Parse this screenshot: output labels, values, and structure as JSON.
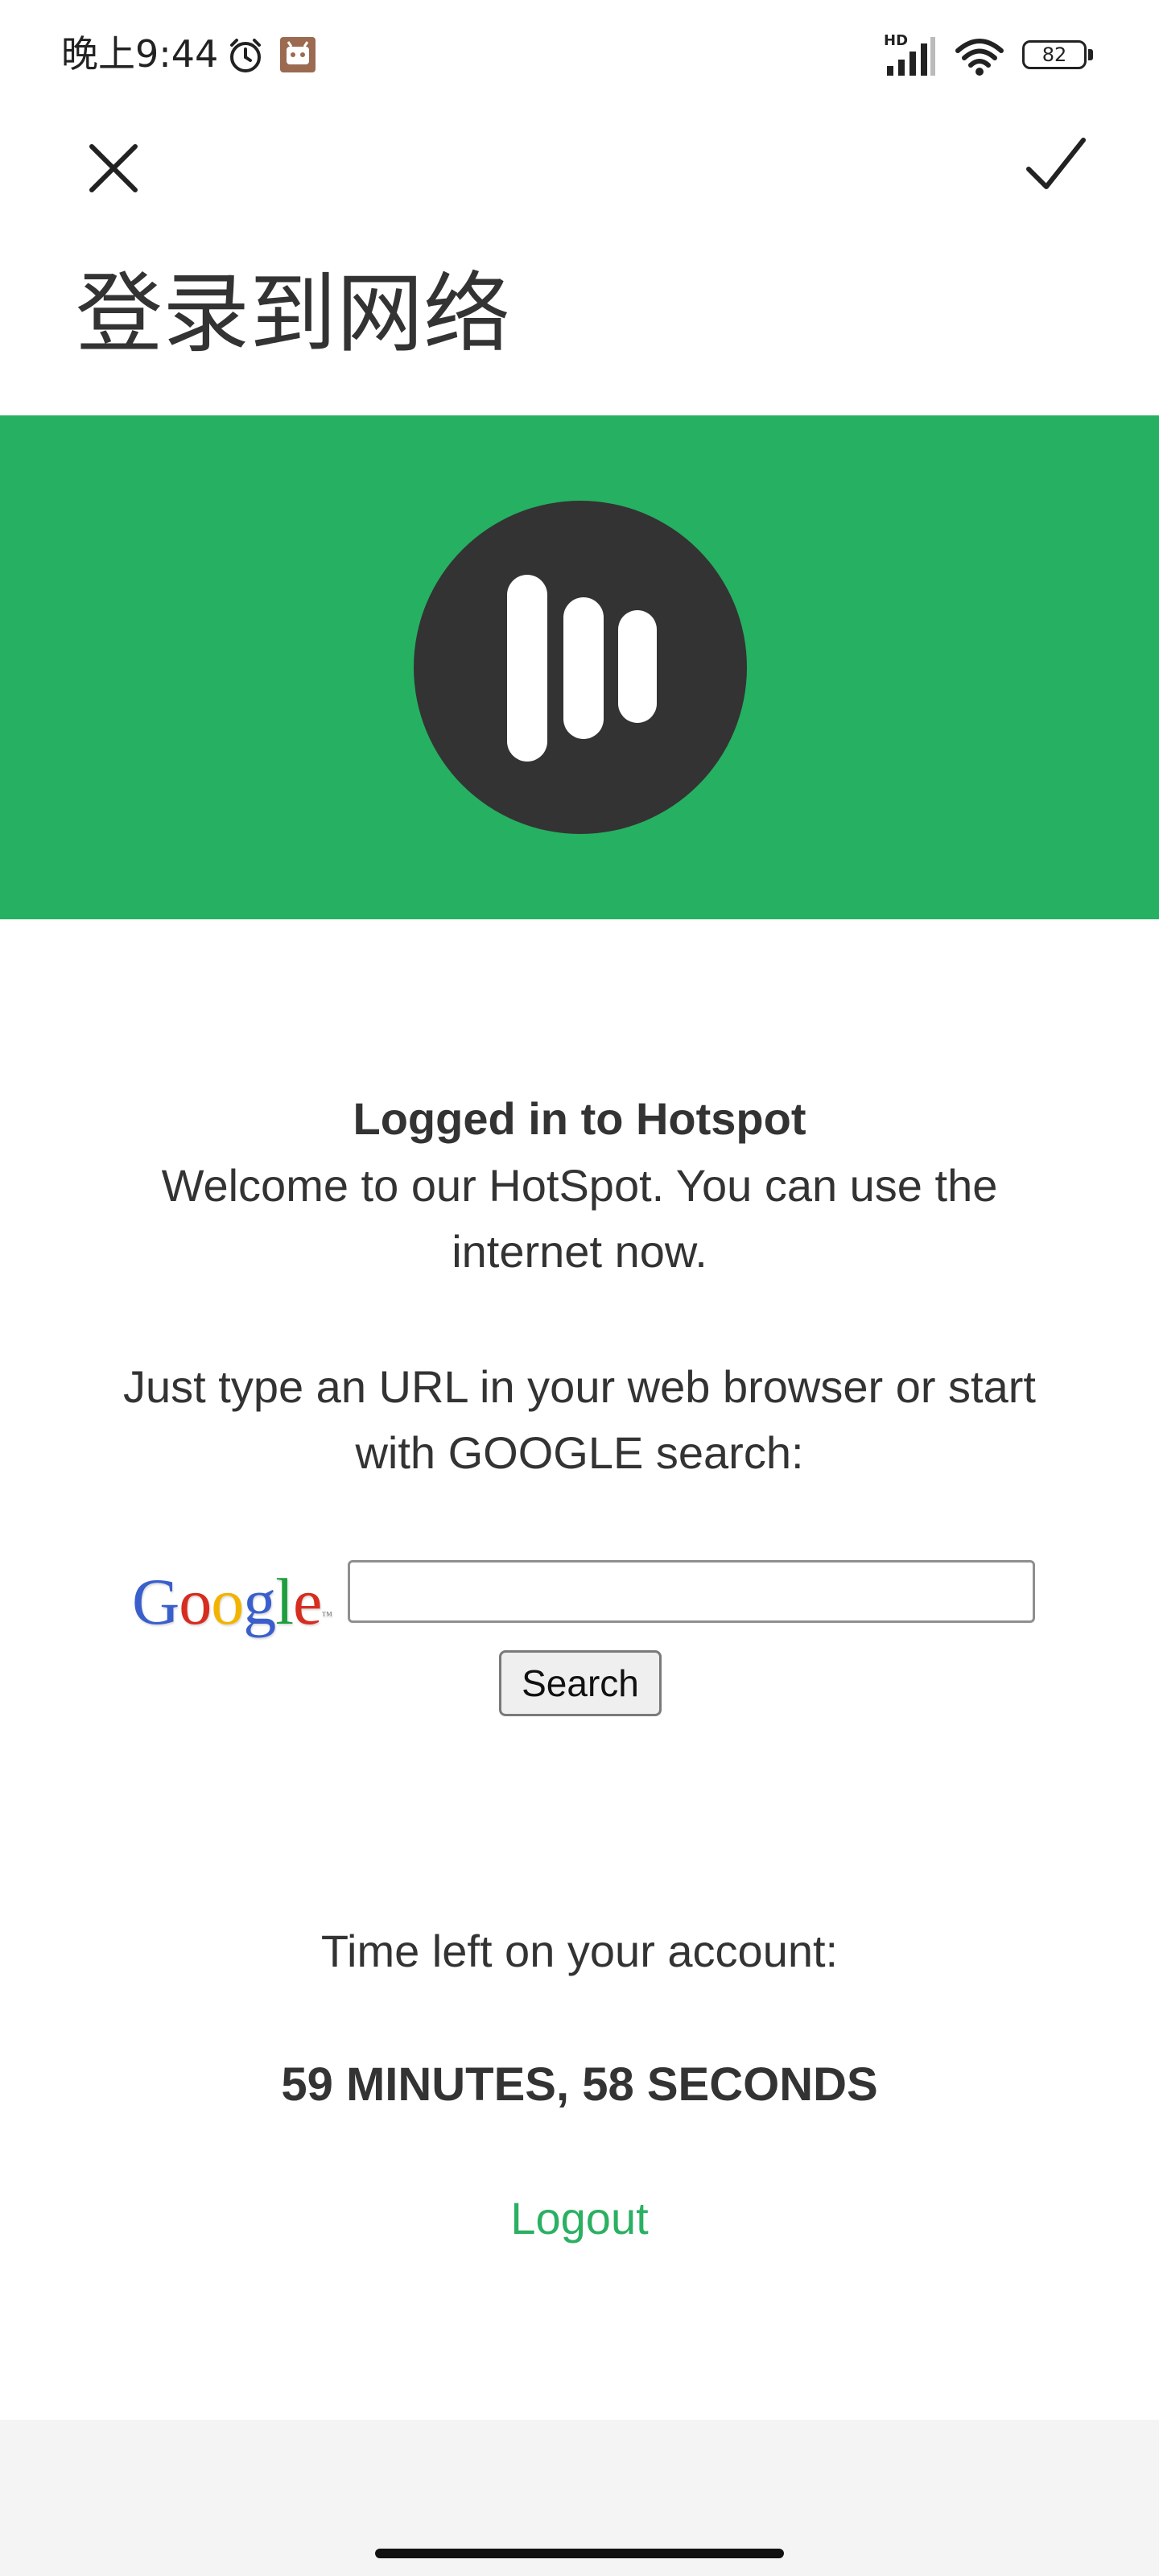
{
  "status_bar": {
    "time": "晚上9:44",
    "battery": "82",
    "network": "HD"
  },
  "header": {
    "title": "登录到网络",
    "close_icon": "close-icon",
    "confirm_icon": "check-icon"
  },
  "hero": {
    "color": "#26b062",
    "logo_color": "#333333"
  },
  "content": {
    "heading": "Logged in to Hotspot",
    "welcome": "Welcome to our HotSpot. You can use the internet now.",
    "instructions": "Just type an URL in your web browser or start with GOOGLE search:",
    "google_logo": "Google",
    "google_tm": "™",
    "search_input_value": "",
    "search_button": "Search",
    "time_label": "Time left on your account:",
    "time_value": "59 MINUTES, 58 SECONDS",
    "logout_link": "Logout"
  },
  "colors": {
    "accent": "#2bb063",
    "text": "#333333"
  }
}
